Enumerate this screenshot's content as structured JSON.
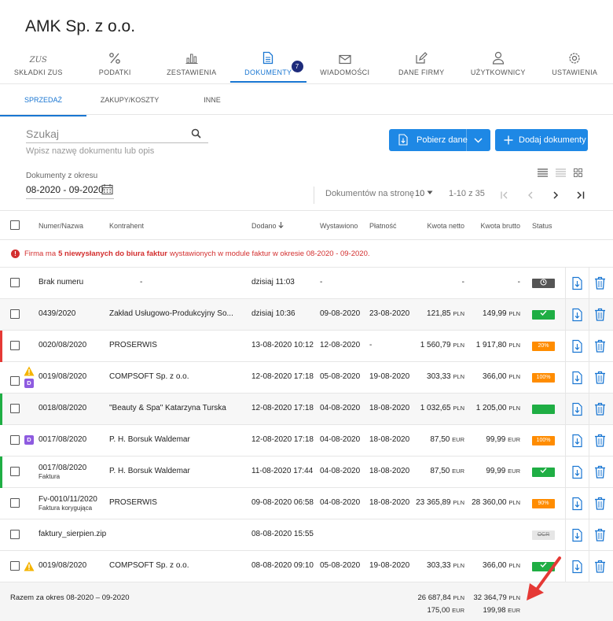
{
  "company": "AMK Sp. z o.o.",
  "nav": [
    {
      "label": "SKŁADKI ZUS",
      "icon": "zus-icon"
    },
    {
      "label": "PODATKI",
      "icon": "percent-icon"
    },
    {
      "label": "ZESTAWIENIA",
      "icon": "bar-chart-icon"
    },
    {
      "label": "DOKUMENTY",
      "icon": "document-icon",
      "badge": "7"
    },
    {
      "label": "WIADOMOŚCI",
      "icon": "envelope-icon"
    },
    {
      "label": "DANE FIRMY",
      "icon": "edit-icon"
    },
    {
      "label": "UŻYTKOWNICY",
      "icon": "user-icon"
    },
    {
      "label": "USTAWIENIA",
      "icon": "gear-icon"
    }
  ],
  "zus_glyph": "ZUS",
  "subtabs": [
    "SPRZEDAŻ",
    "ZAKUPY/KOSZTY",
    "INNE"
  ],
  "search": {
    "placeholder": "Szukaj",
    "hint": "Wpisz nazwę dokumentu lub opis"
  },
  "buttons": {
    "pobierz": "Pobierz dane",
    "dodaj": "Dodaj dokumenty"
  },
  "period": {
    "label": "Dokumenty z okresu",
    "value": "08-2020 - 09-2020"
  },
  "pager": {
    "per_page_label": "Dokumentów na stronę",
    "per_page": "10",
    "range": "1-10 z 35"
  },
  "columns": {
    "numer": "Numer/Nazwa",
    "kontrahent": "Kontrahent",
    "dodano": "Dodano",
    "wystawiono": "Wystawiono",
    "platnosc": "Płatność",
    "netto": "Kwota netto",
    "brutto": "Kwota brutto",
    "status": "Status"
  },
  "warning": {
    "prefix": "Firma ma ",
    "count": "5 niewysłanych do biura faktur",
    "suffix": " wystawionych w module faktur w okresie 08-2020 - 09-2020."
  },
  "rows": [
    {
      "numer": "Brak numeru",
      "sub": "",
      "kontrahent": "-",
      "dodano": "dzisiaj 11:03",
      "wystawiono": "-",
      "platnosc": "",
      "netto": "-",
      "netto_cur": "",
      "brutto": "-",
      "brutto_cur": "",
      "status": "",
      "status_type": "clock"
    },
    {
      "numer": "0439/2020",
      "sub": "",
      "kontrahent": "Zakład Usługowo-Produkcyjny So...",
      "dodano": "dzisiaj 10:36",
      "wystawiono": "09-08-2020",
      "platnosc": "23-08-2020",
      "netto": "121,85",
      "netto_cur": "PLN",
      "brutto": "149,99",
      "brutto_cur": "PLN",
      "status": "",
      "status_type": "check"
    },
    {
      "numer": "0020/08/2020",
      "sub": "",
      "kontrahent": "PROSERWIS",
      "dodano": "13-08-2020 10:12",
      "wystawiono": "12-08-2020",
      "platnosc": "-",
      "netto": "1 560,79",
      "netto_cur": "PLN",
      "brutto": "1 917,80",
      "brutto_cur": "PLN",
      "status": "20%",
      "status_type": "orange"
    },
    {
      "numer": "0019/08/2020",
      "sub": "",
      "kontrahent": "COMPSOFT Sp. z o.o.",
      "dodano": "12-08-2020 17:18",
      "wystawiono": "05-08-2020",
      "platnosc": "19-08-2020",
      "netto": "303,33",
      "netto_cur": "PLN",
      "brutto": "366,00",
      "brutto_cur": "PLN",
      "status": "100%",
      "status_type": "orange"
    },
    {
      "numer": "0018/08/2020",
      "sub": "",
      "kontrahent": "\"Beauty & Spa\" Katarzyna Turska",
      "dodano": "12-08-2020 17:18",
      "wystawiono": "04-08-2020",
      "platnosc": "18-08-2020",
      "netto": "1 032,65",
      "netto_cur": "PLN",
      "brutto": "1 205,00",
      "brutto_cur": "PLN",
      "status": "",
      "status_type": "green"
    },
    {
      "numer": "0017/08/2020",
      "sub": "",
      "kontrahent": "P. H. Borsuk Waldemar",
      "dodano": "12-08-2020 17:18",
      "wystawiono": "04-08-2020",
      "platnosc": "18-08-2020",
      "netto": "87,50",
      "netto_cur": "EUR",
      "brutto": "99,99",
      "brutto_cur": "EUR",
      "status": "100%",
      "status_type": "orange"
    },
    {
      "numer": "0017/08/2020",
      "sub": "Faktura",
      "kontrahent": "P. H. Borsuk Waldemar",
      "dodano": "11-08-2020 17:44",
      "wystawiono": "04-08-2020",
      "platnosc": "18-08-2020",
      "netto": "87,50",
      "netto_cur": "EUR",
      "brutto": "99,99",
      "brutto_cur": "EUR",
      "status": "",
      "status_type": "check"
    },
    {
      "numer": "Fv-0010/11/2020",
      "sub": "Faktura korygująca",
      "kontrahent": "PROSERWIS",
      "dodano": "09-08-2020 06:58",
      "wystawiono": "04-08-2020",
      "platnosc": "18-08-2020",
      "netto": "23 365,89",
      "netto_cur": "PLN",
      "brutto": "28 360,00",
      "brutto_cur": "PLN",
      "status": "90%",
      "status_type": "orange"
    },
    {
      "numer": "faktury_sierpien.zip",
      "sub": "",
      "kontrahent": "",
      "dodano": "08-08-2020 15:55",
      "wystawiono": "",
      "platnosc": "",
      "netto": "",
      "netto_cur": "",
      "brutto": "",
      "brutto_cur": "",
      "status": "OCR",
      "status_type": "ocr"
    },
    {
      "numer": "0019/08/2020",
      "sub": "",
      "kontrahent": "COMPSOFT Sp. z o.o.",
      "dodano": "08-08-2020 09:10",
      "wystawiono": "05-08-2020",
      "platnosc": "19-08-2020",
      "netto": "303,33",
      "netto_cur": "PLN",
      "brutto": "366,00",
      "brutto_cur": "PLN",
      "status": "",
      "status_type": "check"
    }
  ],
  "badge_d": "D",
  "footer": {
    "label": "Razem za okres 08-2020 – 09-2020",
    "netto_pln": "26 687,84",
    "brutto_pln": "32 364,79",
    "cur_pln": "PLN",
    "netto_eur": "175,00",
    "brutto_eur": "199,98",
    "cur_eur": "EUR"
  },
  "colors": {
    "accent": "#1976d2",
    "button": "#1e88e5",
    "green": "#1fae44",
    "orange": "#ff8c00",
    "red": "#d32f2f",
    "purple": "#8e5be0",
    "arrow": "#e53935"
  }
}
